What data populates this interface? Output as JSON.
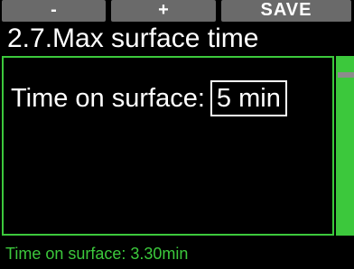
{
  "softkeys": {
    "minus_label": "-",
    "plus_label": "+",
    "save_label": "SAVE"
  },
  "title": "2.7.Max surface time",
  "field": {
    "label": "Time on surface:",
    "value": "5 min"
  },
  "status": "Time on surface: 3.30min",
  "colors": {
    "accent_green": "#3cc83c",
    "softkey_gray": "#6a6a6a",
    "background": "#000000",
    "text": "#ffffff"
  }
}
